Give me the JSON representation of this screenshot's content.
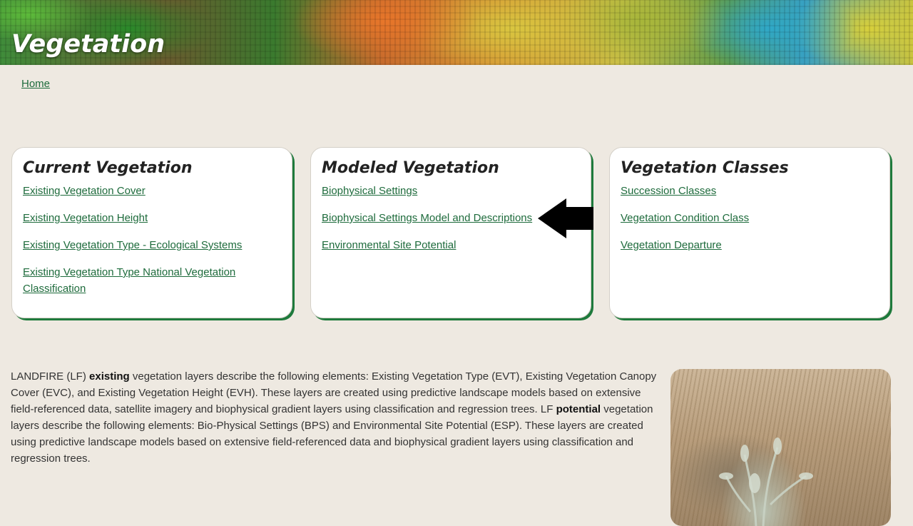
{
  "header": {
    "title": "Vegetation"
  },
  "breadcrumb": {
    "home": "Home"
  },
  "cards": [
    {
      "title": "Current Vegetation",
      "links": [
        "Existing Vegetation Cover",
        "Existing Vegetation Height",
        "Existing Vegetation Type - Ecological Systems",
        "Existing Vegetation Type National Vegetation Classification"
      ]
    },
    {
      "title": "Modeled Vegetation",
      "links": [
        "Biophysical Settings",
        "Biophysical Settings Model and Descriptions",
        "Environmental Site Potential"
      ]
    },
    {
      "title": "Vegetation Classes",
      "links": [
        "Succession Classes",
        "Vegetation Condition Class",
        "Vegetation Departure"
      ]
    }
  ],
  "intro": {
    "p1": "LANDFIRE (LF) ",
    "b1": "existing",
    "p2": " vegetation layers describe the following elements: Existing Vegetation Type (EVT), Existing Vegetation Canopy Cover (EVC), and Existing Vegetation Height (EVH). These layers are created using predictive landscape models based on extensive field-referenced data, satellite imagery and biophysical gradient layers using classification and regression trees. LF ",
    "b2": "potential",
    "p3": " vegetation layers describe the following elements: Bio-Physical Settings (BPS) and Environmental Site Potential (ESP). These layers are created using predictive landscape models based on extensive field-referenced data and biophysical gradient layers using classification and regression trees."
  },
  "icons": {
    "pointer": "arrow-left-icon"
  },
  "colors": {
    "link": "#1e6b3c",
    "card_accent": "#1e7a3c",
    "background": "#eee9e1"
  }
}
